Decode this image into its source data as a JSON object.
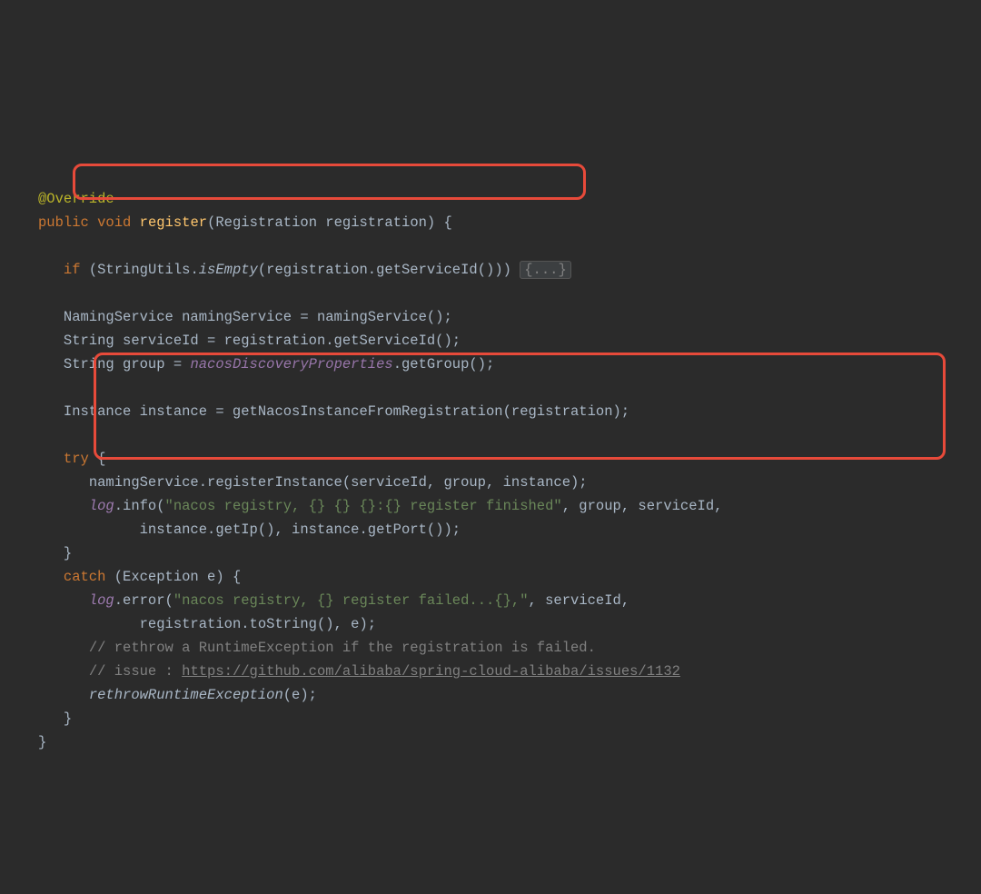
{
  "colors": {
    "bg": "#2b2b2b",
    "fg": "#a9b7c6",
    "keyword": "#cc7832",
    "annotation": "#bbb529",
    "method": "#ffc66d",
    "field": "#9876aa",
    "string": "#6a8759",
    "comment": "#808080",
    "highlight_border": "#e74a3a"
  },
  "t": {
    "anno": "@Override",
    "public": "public",
    "void": "void",
    "register": "register",
    "sig_params": "(Registration registration) {",
    "if": "if",
    "isEmpty": "isEmpty",
    "if_pre": "(StringUtils.",
    "if_post": "(registration.getServiceId())) ",
    "fold": "{...}",
    "l3": "NamingService namingService = namingService();",
    "l4": "String serviceId = registration.getServiceId();",
    "l5a": "String group = ",
    "l5b": "nacosDiscoveryProperties",
    "l5c": ".getGroup();",
    "l6": "Instance instance = getNacosInstanceFromRegistration(registration);",
    "try": "try",
    "brace_open": " {",
    "l7": "namingService.registerInstance(serviceId, group, instance);",
    "log": "log",
    "l8a": ".info(",
    "l8s": "\"nacos registry, {} {} {}:{} register finished\"",
    "l8b": ", group, serviceId,",
    "l9": "instance.getIp(), instance.getPort());",
    "brace_close": "}",
    "catch": "catch",
    "catch_sig": " (Exception e) {",
    "l10a": ".error(",
    "l10s": "\"nacos registry, {} register failed...{},\"",
    "l10b": ", serviceId,",
    "l11": "registration.toString(), e);",
    "c1": "// rethrow a RuntimeException if the registration is failed.",
    "c2a": "// issue : ",
    "c2l": "https://github.com/alibaba/spring-cloud-alibaba/issues/1132",
    "l12a": "rethrowRuntimeException",
    "l12b": "(e);"
  }
}
